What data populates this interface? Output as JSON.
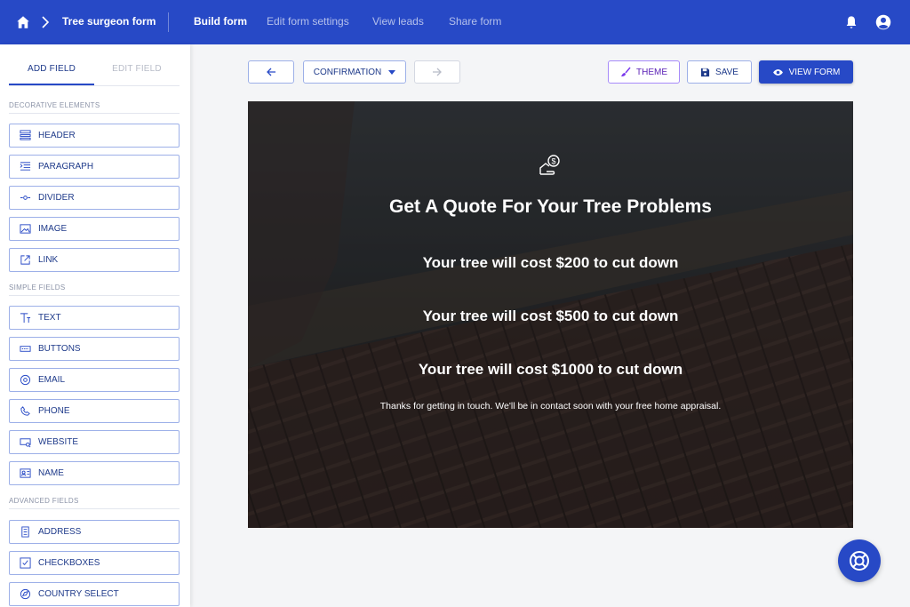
{
  "topbar": {
    "form_title": "Tree surgeon form",
    "nav": [
      "Build form",
      "Edit form settings",
      "View leads",
      "Share form"
    ],
    "active_nav": "Build form",
    "brand_color": "#2749c6"
  },
  "sidebar": {
    "tabs": {
      "add_field": "ADD FIELD",
      "edit_field": "EDIT FIELD"
    },
    "sections": {
      "decorative": "DECORATIVE ELEMENTS",
      "simple": "SIMPLE FIELDS",
      "advanced": "ADVANCED FIELDS"
    },
    "decorative_items": [
      {
        "label": "HEADER",
        "icon": "header-icon"
      },
      {
        "label": "PARAGRAPH",
        "icon": "paragraph-icon"
      },
      {
        "label": "DIVIDER",
        "icon": "divider-icon"
      },
      {
        "label": "IMAGE",
        "icon": "image-icon"
      },
      {
        "label": "LINK",
        "icon": "link-icon"
      }
    ],
    "simple_items": [
      {
        "label": "TEXT",
        "icon": "text-icon"
      },
      {
        "label": "BUTTONS",
        "icon": "buttons-icon"
      },
      {
        "label": "EMAIL",
        "icon": "email-icon"
      },
      {
        "label": "PHONE",
        "icon": "phone-icon"
      },
      {
        "label": "WEBSITE",
        "icon": "website-icon"
      },
      {
        "label": "NAME",
        "icon": "name-icon"
      }
    ],
    "advanced_items": [
      {
        "label": "ADDRESS",
        "icon": "address-icon"
      },
      {
        "label": "CHECKBOXES",
        "icon": "checkboxes-icon"
      },
      {
        "label": "COUNTRY SELECT",
        "icon": "country-select-icon"
      }
    ]
  },
  "toolbar": {
    "step_select": "CONFIRMATION",
    "theme_label": "THEME",
    "save_label": "SAVE",
    "view_form_label": "VIEW FORM"
  },
  "preview": {
    "title": "Get A Quote For Your Tree Problems",
    "lines": [
      "Your tree will cost $200 to cut down",
      "Your tree will cost $500 to cut down",
      "Your tree will cost $1000 to cut down"
    ],
    "message": "Thanks for getting in touch. We'll be in contact soon with your free home appraisal."
  }
}
